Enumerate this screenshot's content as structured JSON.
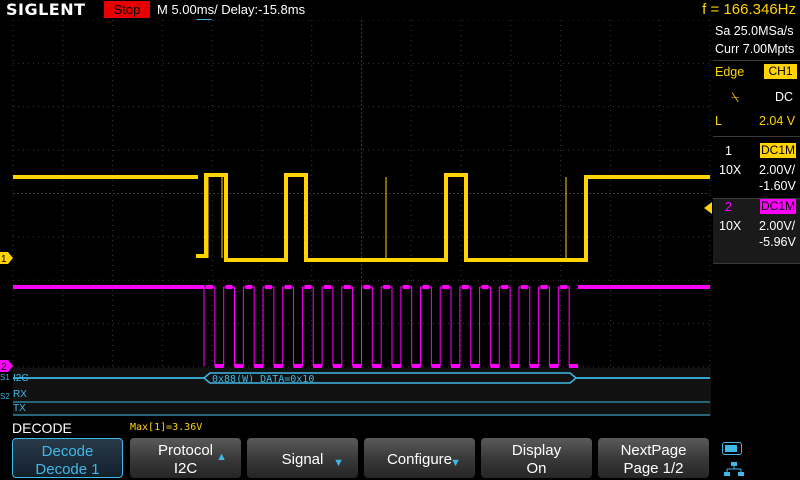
{
  "header": {
    "brand": "SIGLENT",
    "status": "Stop",
    "timebase": "M 5.00ms/ Delay:-15.8ms",
    "frequency": "f = 166.346Hz"
  },
  "acquisition": {
    "sample_rate": "Sa 25.0MSa/s",
    "memory_depth": "Curr 7.00Mpts"
  },
  "trigger": {
    "type": "Edge",
    "source": "CH1",
    "coupling": "DC",
    "level_label": "L",
    "level": "2.04 V"
  },
  "channels": [
    {
      "num": "1",
      "coupling": "DC1M",
      "probe": "10X",
      "scale": "2.00V/",
      "offset": "-1.60V",
      "color": "#ffd400",
      "marker": "1"
    },
    {
      "num": "2",
      "coupling": "DC1M",
      "probe": "10X",
      "scale": "2.00V/",
      "offset": "-5.96V",
      "color": "#ff00ff",
      "marker": "2"
    }
  ],
  "decode_panel": {
    "bus1_label": "I2C",
    "bus1_marker": "S1",
    "bus2_marker": "S2",
    "bus2_rx": "RX",
    "bus2_tx": "TX",
    "frame_text": "0x88(W) DATA=0x10",
    "title": "DECODE",
    "measure": "Max[1]=3.36V"
  },
  "softkeys": [
    {
      "line1": "Decode",
      "line2": "Decode 1",
      "arrow": ""
    },
    {
      "line1": "Protocol",
      "line2": "I2C",
      "arrow": "up"
    },
    {
      "line1": "Signal",
      "line2": "",
      "arrow": "down"
    },
    {
      "line1": "Configure",
      "line2": "",
      "arrow": "down"
    },
    {
      "line1": "Display",
      "line2": "On",
      "arrow": ""
    },
    {
      "line1": "NextPage",
      "line2": "Page 1/2",
      "arrow": ""
    }
  ],
  "colors": {
    "ch1": "#ffd400",
    "ch2": "#ff00ff",
    "accent": "#3fb8e8",
    "status_stop": "#e60000"
  },
  "icons": {
    "usb": "usb-icon",
    "network": "network-icon"
  },
  "chart_data": {
    "type": "line",
    "series": [
      {
        "name": "1",
        "x": [
          0,
          0.26,
          0.27,
          0.29,
          0.3,
          0.4,
          0.41,
          0.6,
          0.61,
          0.8,
          0.81,
          1.0
        ],
        "values": [
          1,
          1,
          0,
          1,
          0,
          0,
          1,
          1,
          0,
          0,
          1,
          1
        ]
      },
      {
        "name": "2",
        "x": [
          0,
          0.27,
          0.8,
          1.0
        ],
        "values": [
          1,
          1,
          1,
          1
        ]
      }
    ]
  }
}
